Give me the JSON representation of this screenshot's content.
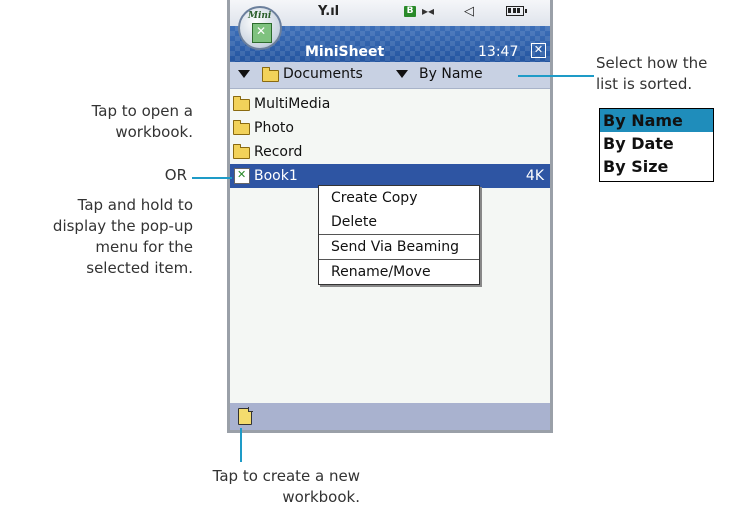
{
  "status": {
    "signal": "Y.ıl",
    "bluetooth": "B",
    "infrared": "▸◂",
    "speaker": "◁"
  },
  "app": {
    "icon_label": "Mini",
    "title": "MiniSheet",
    "time": "13:47"
  },
  "toolbar": {
    "folder": "Documents",
    "sort": "By Name"
  },
  "files": [
    {
      "name": "MultiMedia",
      "type": "folder",
      "size": ""
    },
    {
      "name": "Photo",
      "type": "folder",
      "size": ""
    },
    {
      "name": "Record",
      "type": "folder",
      "size": ""
    },
    {
      "name": "Book1",
      "type": "workbook",
      "size": "4K"
    }
  ],
  "popup_menu": [
    "Create Copy",
    "Delete",
    "Send Via Beaming",
    "Rename/Move"
  ],
  "annotations": {
    "open_workbook": [
      "Tap to open a",
      "workbook."
    ],
    "or": "OR",
    "tap_hold": [
      "Tap and hold to",
      "display the pop-up",
      "menu for the",
      "selected item."
    ],
    "sort_hint": [
      "Select how the",
      "list is sorted."
    ],
    "new_workbook": [
      "Tap to create a new",
      "workbook."
    ]
  },
  "sort_options": [
    "By Name",
    "By Date",
    "By Size"
  ],
  "colors": {
    "selection": "#2e55a3",
    "titlebar": "#2f60ac",
    "accent_line": "#1e9bc7",
    "sort_highlight": "#1f8dbb"
  }
}
